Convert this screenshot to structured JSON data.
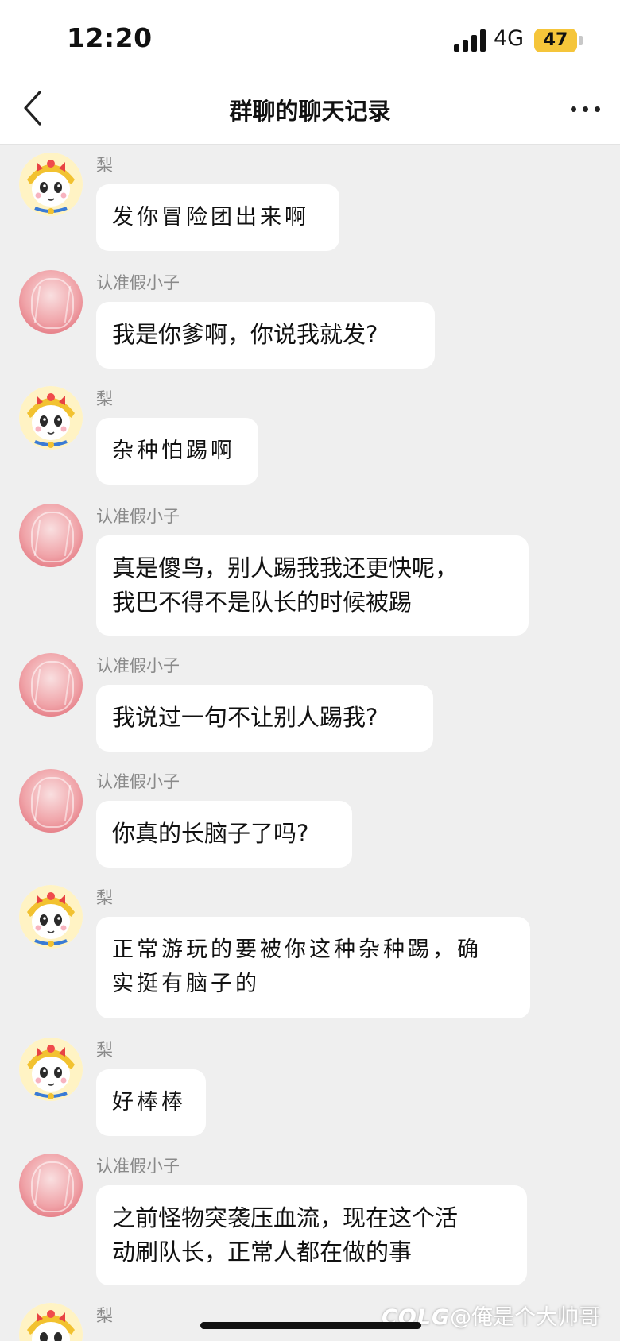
{
  "status": {
    "time": "12:20",
    "network": "4G",
    "battery": "47"
  },
  "header": {
    "title": "群聊的聊天记录"
  },
  "messages": [
    {
      "sender": "梨",
      "text": "发你冒险团出来啊"
    },
    {
      "sender": "认准假小子",
      "text": "我是你爹啊，你说我就发?"
    },
    {
      "sender": "梨",
      "text": "杂种怕踢啊"
    },
    {
      "sender": "认准假小子",
      "text": "真是傻鸟，别人踢我我还更快呢，\n我巴不得不是队长的时候被踢"
    },
    {
      "sender": "认准假小子",
      "text": "我说过一句不让别人踢我?"
    },
    {
      "sender": "认准假小子",
      "text": "你真的长脑子了吗?"
    },
    {
      "sender": "梨",
      "text": "正常游玩的要被你这种杂种踢，确\n实挺有脑子的"
    },
    {
      "sender": "梨",
      "text": "好棒棒"
    },
    {
      "sender": "认准假小子",
      "text": "之前怪物突袭压血流，现在这个活\n动刷队长，正常人都在做的事"
    },
    {
      "sender": "梨",
      "text": ""
    }
  ],
  "watermark": {
    "brand": "COLG",
    "text": "@俺是个大帅哥"
  },
  "colors": {
    "background": "#efefef",
    "bubble": "#ffffff",
    "battery": "#f5c53a"
  }
}
